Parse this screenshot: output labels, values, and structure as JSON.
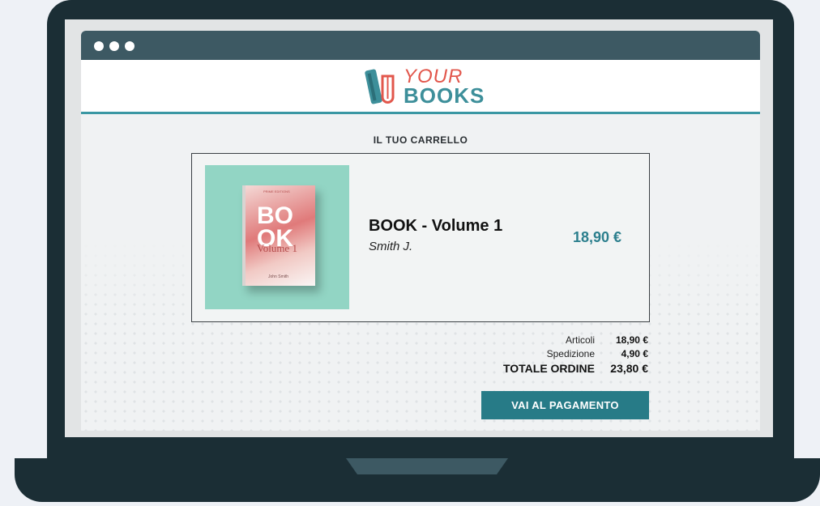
{
  "brand": {
    "logo_your": "YOUR",
    "logo_books": "BOOKS",
    "colors": {
      "accent": "#277b87",
      "logo_red": "#e2574c",
      "logo_teal": "#3d8f9a"
    }
  },
  "cart": {
    "title": "IL TUO CARRELLO",
    "item": {
      "cover_series": "PRIME EDITIONS",
      "cover_title_line1": "BO",
      "cover_title_line2": "OK",
      "cover_subtitle": "Volume 1",
      "cover_author": "John Smith",
      "title": "BOOK - Volume 1",
      "author": "Smith J.",
      "price": "18,90 €"
    }
  },
  "summary": {
    "articles_label": "Articoli",
    "articles_value": "18,90 €",
    "shipping_label": "Spedizione",
    "shipping_value": "4,90 €",
    "total_label": "TOTALE ORDINE",
    "total_value": "23,80 €"
  },
  "checkout": {
    "button_label": "VAI AL PAGAMENTO"
  }
}
